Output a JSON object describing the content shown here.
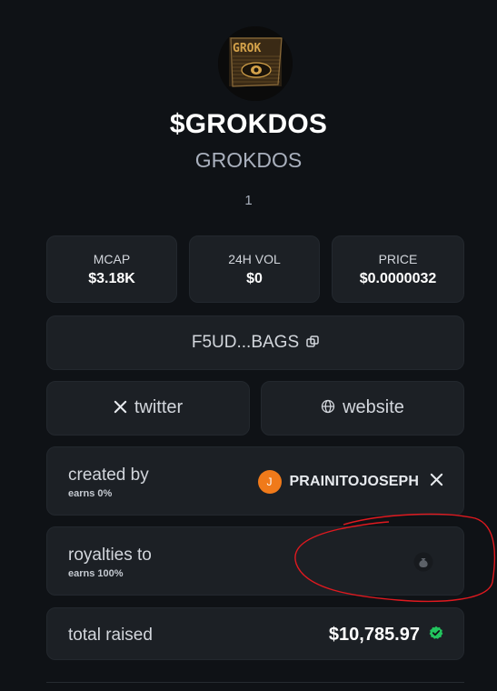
{
  "token": {
    "symbol": "$GROKDOS",
    "name": "GROKDOS",
    "description": "1",
    "image_name": "token-logo"
  },
  "stats": [
    {
      "label": "MCAP",
      "value": "$3.18K"
    },
    {
      "label": "24H VOL",
      "value": "$0"
    },
    {
      "label": "PRICE",
      "value": "$0.0000032"
    }
  ],
  "address": {
    "display": "F5UD...BAGS",
    "icon": "copy-icon"
  },
  "links": {
    "twitter_label": "twitter",
    "twitter_icon": "x-icon",
    "website_label": "website",
    "website_icon": "globe-icon"
  },
  "creator": {
    "label": "created by",
    "earns": "earns 0%",
    "avatar_letter": "J",
    "avatar_color": "#f07a1a",
    "username": "PRAINITOJOSEPH",
    "social_icon": "x-icon"
  },
  "royalties": {
    "label": "royalties to",
    "earns": "earns 100%",
    "icon": "money-bag-icon"
  },
  "raised": {
    "label": "total raised",
    "amount": "$10,785.97",
    "status_icon": "verified-check-icon",
    "status_color": "#22c55e"
  },
  "colors": {
    "background": "#0f1216",
    "card": "#1c2025",
    "annotation": "#e0191f"
  }
}
